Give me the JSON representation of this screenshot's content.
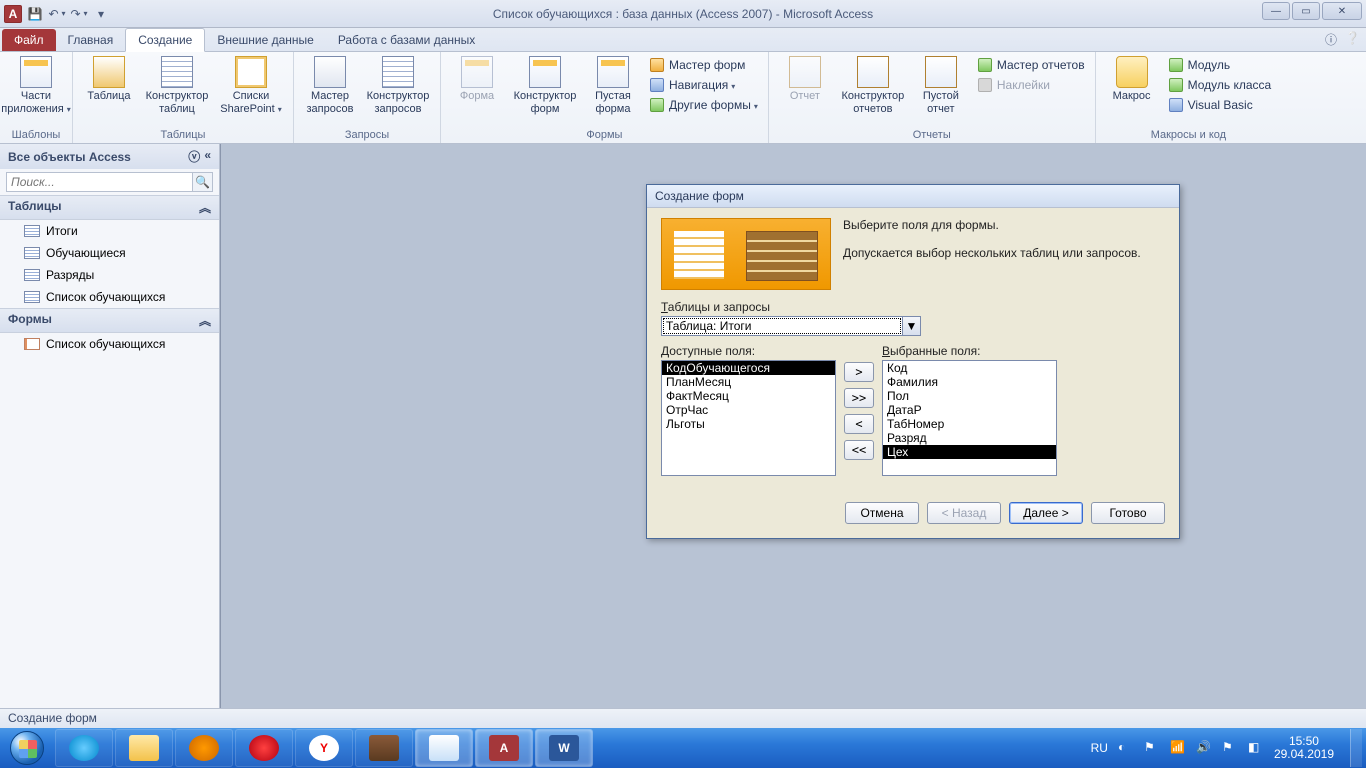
{
  "titlebar": {
    "title": "Список обучающихся : база данных (Access 2007)  -  Microsoft Access"
  },
  "tabs": {
    "file": "Файл",
    "home": "Главная",
    "create": "Создание",
    "external": "Внешние данные",
    "dbtools": "Работа с базами данных"
  },
  "ribbon": {
    "templates": {
      "label": "Шаблоны",
      "app_parts": "Части\nприложения"
    },
    "tables": {
      "label": "Таблицы",
      "table": "Таблица",
      "designer": "Конструктор\nтаблиц",
      "sp_lists": "Списки\nSharePoint"
    },
    "queries": {
      "label": "Запросы",
      "wizard": "Мастер\nзапросов",
      "designer": "Конструктор\nзапросов"
    },
    "forms": {
      "label": "Формы",
      "form": "Форма",
      "designer": "Конструктор\nформ",
      "blank": "Пустая\nформа",
      "form_wizard": "Мастер форм",
      "navigation": "Навигация",
      "other_forms": "Другие формы"
    },
    "reports": {
      "label": "Отчеты",
      "report": "Отчет",
      "designer": "Конструктор\nотчетов",
      "blank": "Пустой\nотчет",
      "report_wizard": "Мастер отчетов",
      "labels": "Наклейки"
    },
    "macros": {
      "label": "Макросы и код",
      "macro": "Макрос",
      "module": "Модуль",
      "class_module": "Модуль класса",
      "vb": "Visual Basic"
    }
  },
  "nav": {
    "header": "Все объекты Access",
    "search_placeholder": "Поиск...",
    "group_tables": "Таблицы",
    "group_forms": "Формы",
    "tables": [
      "Итоги",
      "Обучающиеся",
      "Разряды",
      "Список обучающихся"
    ],
    "forms": [
      "Список обучающихся"
    ]
  },
  "dialog": {
    "title": "Создание форм",
    "instr1": "Выберите поля для формы.",
    "instr2": "Допускается выбор нескольких таблиц или запросов.",
    "tables_queries_label": "Таблицы и запросы",
    "combo_value": "Таблица: Итоги",
    "available_label": "Доступные поля:",
    "selected_label": "Выбранные поля:",
    "available": [
      "КодОбучающегося",
      "ПланМесяц",
      "ФактМесяц",
      "ОтрЧас",
      "Льготы"
    ],
    "available_sel_index": 0,
    "selected": [
      "Код",
      "Фамилия",
      "Пол",
      "ДатаР",
      "ТабНомер",
      "Разряд",
      "Цех"
    ],
    "selected_sel_index": 6,
    "move": {
      "add": ">",
      "add_all": ">>",
      "remove": "<",
      "remove_all": "<<"
    },
    "buttons": {
      "cancel": "Отмена",
      "back": "< Назад",
      "next": "Далее >",
      "finish": "Готово"
    }
  },
  "statusbar": {
    "text": "Создание форм"
  },
  "taskbar": {
    "lang": "RU",
    "time": "15:50",
    "date": "29.04.2019"
  }
}
